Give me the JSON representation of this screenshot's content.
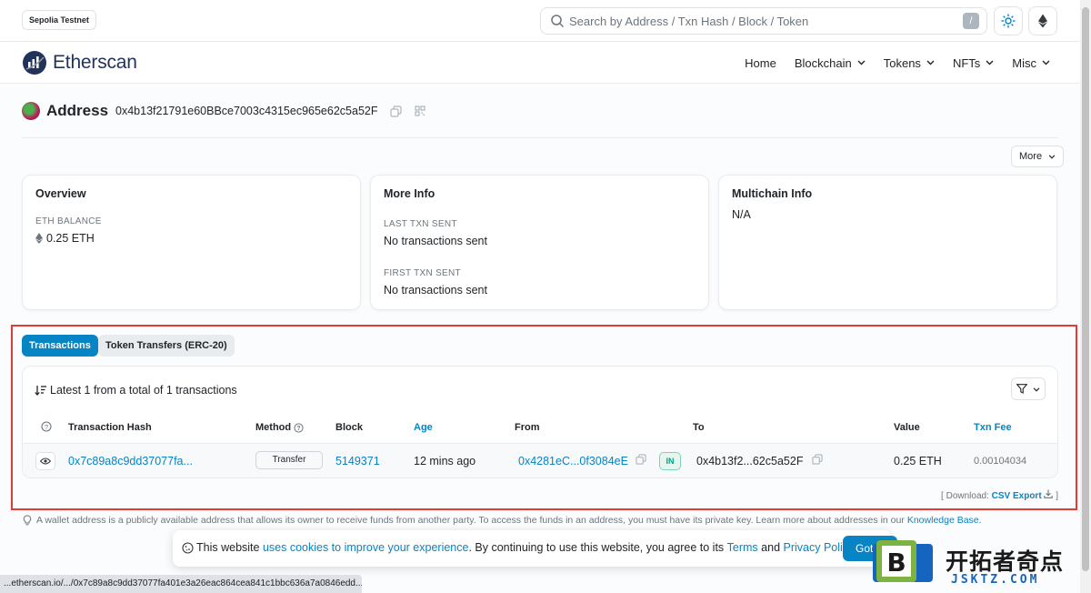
{
  "header": {
    "network_badge": "Sepolia Testnet",
    "search_placeholder": "Search by Address / Txn Hash / Block / Token",
    "search_shortcut": "/",
    "logo_text": "Etherscan",
    "nav": [
      "Home",
      "Blockchain",
      "Tokens",
      "NFTs",
      "Misc"
    ]
  },
  "address": {
    "label": "Address",
    "value": "0x4b13f21791e60BBce7003c4315ec965e62c5a52F",
    "more_label": "More"
  },
  "cards": {
    "overview": {
      "title": "Overview",
      "balance_label": "ETH BALANCE",
      "balance_value": "0.25 ETH"
    },
    "more_info": {
      "title": "More Info",
      "last_label": "LAST TXN SENT",
      "last_value": "No transactions sent",
      "first_label": "FIRST TXN SENT",
      "first_value": "No transactions sent"
    },
    "multichain": {
      "title": "Multichain Info",
      "value": "N/A"
    }
  },
  "tabs": [
    "Transactions",
    "Token Transfers (ERC-20)"
  ],
  "transactions": {
    "summary": "Latest 1 from a total of 1 transactions",
    "columns": [
      "Transaction Hash",
      "Method",
      "Block",
      "Age",
      "From",
      "To",
      "Value",
      "Txn Fee"
    ],
    "rows": [
      {
        "hash": "0x7c89a8c9dd37077fa...",
        "method": "Transfer",
        "block": "5149371",
        "age": "12 mins ago",
        "from": "0x4281eC...0f3084eE",
        "direction": "IN",
        "to": "0x4b13f2...62c5a52F",
        "value": "0.25 ETH",
        "fee": "0.00104034"
      }
    ]
  },
  "download": {
    "prefix": "[ Download:",
    "link": "CSV Export",
    "suffix": "]"
  },
  "tip": {
    "text": "A wallet address is a publicly available address that allows its owner to receive funds from another party. To access the funds in an address, you must have its private key. Learn more about addresses in our",
    "link": "Knowledge Base."
  },
  "cookie": {
    "t1": "This website ",
    "l1": "uses cookies to improve your experience",
    "t2": ". By continuing to use this website, you agree to its ",
    "l2": "Terms",
    "t3": " and ",
    "l3": "Privacy Policy",
    "t4": ".",
    "button": "Got it!"
  },
  "status_url": "...etherscan.io/.../0x7c89a8c9dd37077fa401e3a26eac864cea841c1bbc636a7a0846edd...",
  "watermark": {
    "title": "开拓者奇点",
    "sub": "JSKTZ.COM"
  },
  "colors": {
    "primary": "#0784c3",
    "highlight_box": "#e53935",
    "in_badge": "#00a186"
  }
}
